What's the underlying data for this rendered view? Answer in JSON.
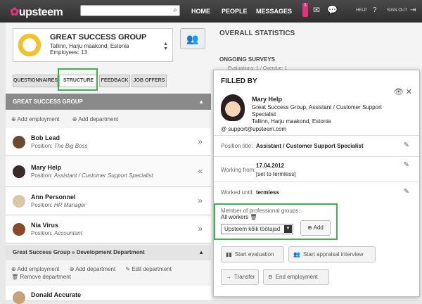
{
  "topbar": {
    "logo": "upsteem",
    "search_placeholder": "",
    "nav": [
      "HOME",
      "PEOPLE",
      "MESSAGES"
    ],
    "help": "HELP",
    "signout": "SIGN OUT",
    "notif_count": "1"
  },
  "group": {
    "name": "GREAT SUCCESS GROUP",
    "address": "Tallinn, Harju maakond, Estonia",
    "employees": "Employees: 13"
  },
  "tabs": [
    "QUESTIONNAIRES",
    "STRUCTURE",
    "FEEDBACK",
    "JOB OFFERS"
  ],
  "section_title": "GREAT SUCCESS GROUP",
  "add_employment": "Add employment",
  "add_department": "Add department",
  "edit_department": "Edit department",
  "remove_department": "Remove department",
  "people": [
    {
      "name": "Bob Lead",
      "position": "The Big Boss"
    },
    {
      "name": "Mary Help",
      "position": "Assistant / Customer Support Specialist"
    },
    {
      "name": "Ann Personnel",
      "position": "HR Manager"
    },
    {
      "name": "Nia Virus",
      "position": "Accountant"
    }
  ],
  "position_prefix": "Position:",
  "dev_dept": "Great Success Group » Development Department",
  "dev_person": {
    "name": "Donald Accurate"
  },
  "stats": {
    "title": "OVERALL STATISTICS",
    "ongoing": "ONGOING SURVEYS",
    "ongoing_sub": "Evaluations: 1 / Overdue: 1"
  },
  "popup": {
    "title": "FILLED BY",
    "name": "Mary Help",
    "desc": "Great Success Group, Assistant / Customer Support Specialist",
    "location": "Tallinn, Harju maakond, Estonia",
    "email": "support@upsteem.com",
    "position_label": "Position title:",
    "position_value": "Assistant / Customer Support Specialist",
    "working_from_label": "Working from:",
    "working_from_value": "17.04.2012",
    "set_termless": "[set to termless]",
    "worked_until_label": "Worked until:",
    "worked_until_value": "termless",
    "groups_label": "Member of professional groups:",
    "groups_all": "All workers",
    "groups_select": "Upsteem kõik töötajad",
    "groups_add": "Add",
    "btn_eval": "Start evaluation",
    "btn_appraisal": "Start appraisal interview",
    "btn_transfer": "Transfer",
    "btn_end": "End employment"
  }
}
